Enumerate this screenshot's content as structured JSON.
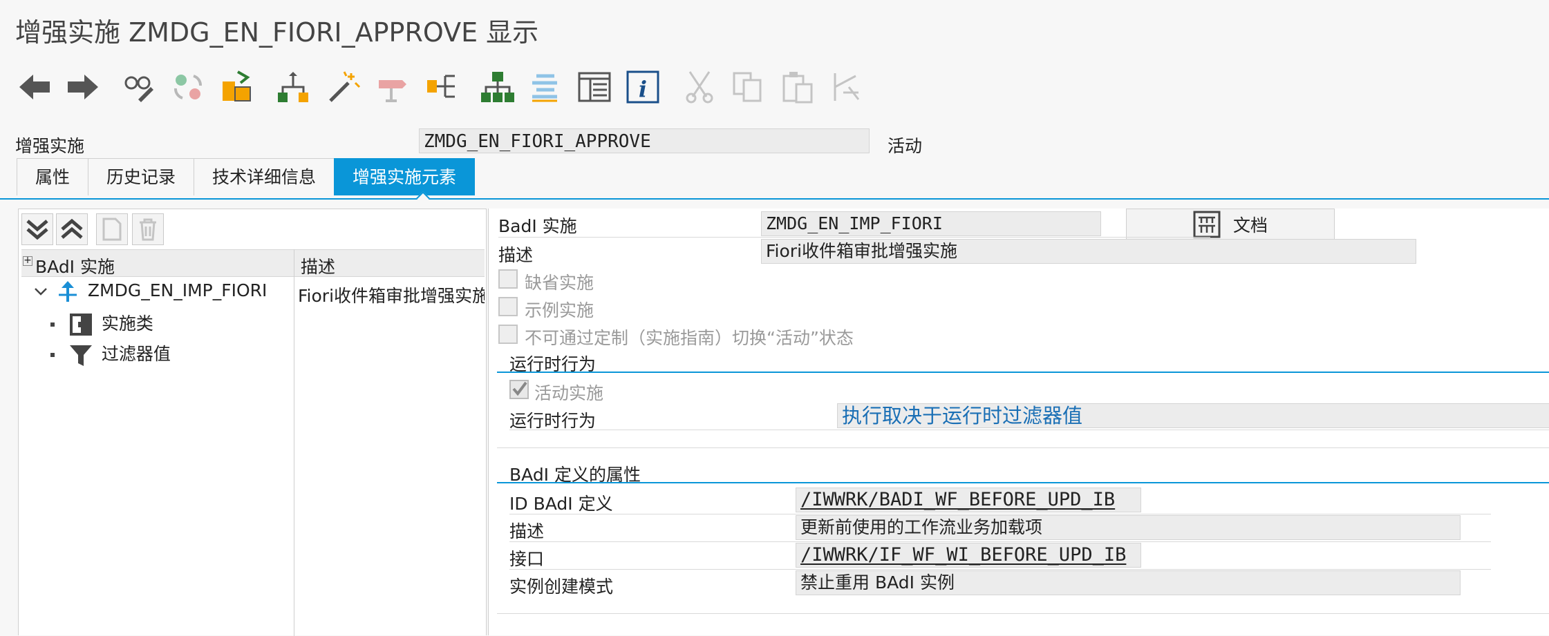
{
  "window": {
    "title": "增强实施 ZMDG_EN_FIORI_APPROVE 显示"
  },
  "toolbar": {
    "buttons": [
      {
        "icon": "back-arrow-icon"
      },
      {
        "icon": "forward-arrow-icon"
      },
      {
        "icon": "display-change-icon"
      },
      {
        "icon": "activate-icon"
      },
      {
        "icon": "object-list-icon"
      },
      {
        "icon": "hierarchy-icon"
      },
      {
        "icon": "magic-wand-icon"
      },
      {
        "icon": "where-used-icon"
      },
      {
        "icon": "tree-expand-icon"
      },
      {
        "icon": "org-chart-icon"
      },
      {
        "icon": "stack-icon"
      },
      {
        "icon": "table-layout-icon"
      },
      {
        "icon": "info-icon"
      },
      {
        "icon": "cut-icon"
      },
      {
        "icon": "copy-icon"
      },
      {
        "icon": "paste-icon"
      },
      {
        "icon": "undo-icon"
      }
    ]
  },
  "header": {
    "label": "增强实施",
    "value": "ZMDG_EN_FIORI_APPROVE",
    "status": "活动"
  },
  "tabs": [
    {
      "label": "属性"
    },
    {
      "label": "历史记录"
    },
    {
      "label": "技术详细信息"
    },
    {
      "label": "增强实施元素",
      "active": true
    }
  ],
  "tree": {
    "col1": "BAdI 实施",
    "col2": "描述",
    "root": {
      "label": "ZMDG_EN_IMP_FIORI",
      "desc": "Fiori收件箱审批增强实施"
    },
    "children": [
      {
        "label": "实施类",
        "icon": "class-icon"
      },
      {
        "label": "过滤器值",
        "icon": "filter-icon"
      }
    ]
  },
  "detail": {
    "badi_impl_label": "BadI 实施",
    "badi_impl_value": "ZMDG_EN_IMP_FIORI",
    "doc_button": "文档",
    "desc_label": "描述",
    "desc_value": "Fiori收件箱审批增强实施",
    "checkboxes": [
      {
        "label": "缺省实施",
        "checked": false
      },
      {
        "label": "示例实施",
        "checked": false
      },
      {
        "label": "不可通过定制（实施指南）切换“活动”状态",
        "checked": false
      }
    ],
    "runtime": {
      "group_title": "运行时行为",
      "active_label": "活动实施",
      "active_checked": true,
      "behavior_label": "运行时行为",
      "behavior_value": "执行取决于运行时过滤器值"
    },
    "badi_def": {
      "group_title": "BAdI 定义的属性",
      "rows": [
        {
          "label": "ID BAdI 定义",
          "value": "/IWWRK/BADI_WF_BEFORE_UPD_IB"
        },
        {
          "label": "描述",
          "value": "更新前使用的工作流业务加载项"
        },
        {
          "label": "接口",
          "value": "/IWWRK/IF_WF_WI_BEFORE_UPD_IB"
        },
        {
          "label": "实例创建模式",
          "value": "禁止重用 BAdI 实例"
        }
      ]
    }
  },
  "colors": {
    "accent": "#0a96d8",
    "link": "#1a6fb5"
  }
}
